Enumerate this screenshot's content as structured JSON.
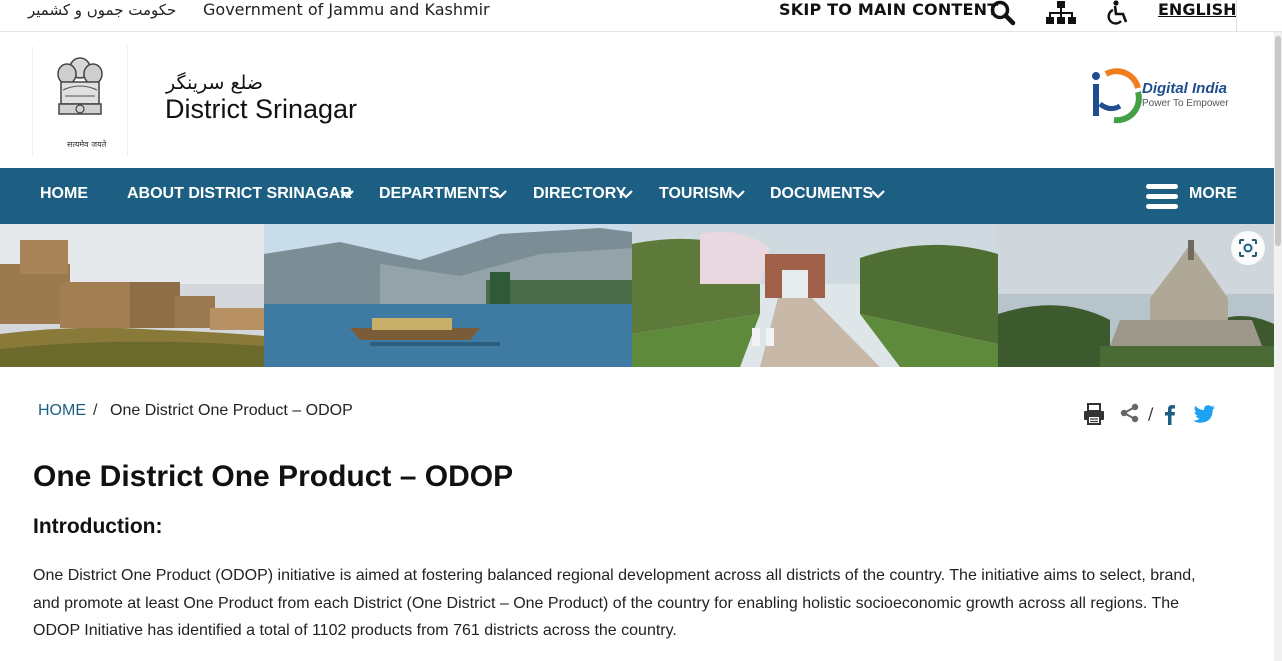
{
  "topbar": {
    "urdu_gov": "حکومت جموں و کشمیر",
    "gov_name": "Government of Jammu and Kashmir",
    "skip": "SKIP TO MAIN CONTENT",
    "language": "ENGLISH",
    "icons": [
      "search-icon",
      "sitemap-icon",
      "accessibility-icon"
    ]
  },
  "header": {
    "site_urdu": "ضلع سرینگر",
    "site_title": "District Srinagar",
    "emblem_caption": "सत्यमेव जयते",
    "digital_india_title": "Digital India",
    "digital_india_tagline": "Power To Empower"
  },
  "nav": {
    "items": [
      {
        "label": "HOME"
      },
      {
        "label": "ABOUT DISTRICT SRINAGAR"
      },
      {
        "label": "DEPARTMENTS"
      },
      {
        "label": "DIRECTORY"
      },
      {
        "label": "TOURISM"
      },
      {
        "label": "DOCUMENTS"
      }
    ],
    "more": "MORE",
    "bg_color": "#1d5f82"
  },
  "breadcrumb": {
    "home": "HOME",
    "separator": "/",
    "current": "One District One Product – ODOP"
  },
  "share": {
    "icons": [
      "print-icon",
      "share-icon",
      "facebook-icon",
      "twitter-icon"
    ],
    "separator": "/"
  },
  "content": {
    "title": "One District One Product – ODOP",
    "heading": "Introduction:",
    "paragraph": "One District One Product (ODOP) initiative is aimed at fostering balanced regional development across all districts of the country. The initiative aims to select, brand, and promote at least One Product from each District (One District – One Product) of the country for enabling holistic socioeconomic growth across all regions. The ODOP Initiative has identified a total of 1102 products from 761 districts across the country."
  }
}
